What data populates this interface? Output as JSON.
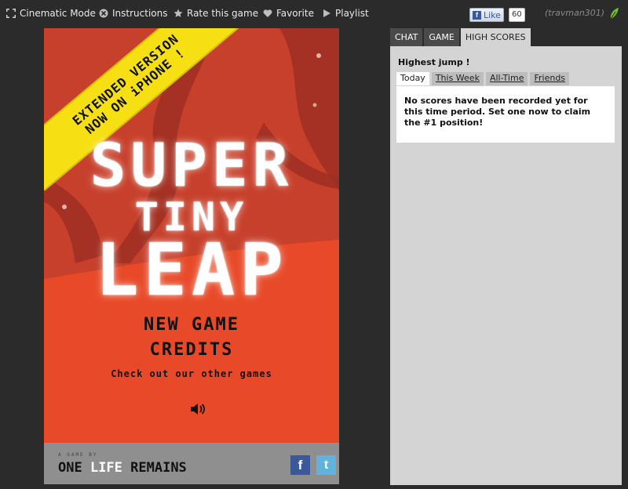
{
  "toolbar": {
    "cinematic": "Cinematic Mode",
    "instructions": "Instructions",
    "rate": "Rate this game",
    "favorite": "Favorite",
    "playlist": "Playlist",
    "like_label": "Like",
    "like_count": "60",
    "username": "(travman301)"
  },
  "game": {
    "banner_line1": "EXTENDED VERSION",
    "banner_line2": "NOW ON iPHONE !",
    "title_1": "SUPER",
    "title_2": "TINY",
    "title_3": "LEAP",
    "menu_new_game": "NEW GAME",
    "menu_credits": "CREDITS",
    "menu_other": "Check out our other games",
    "footer_by": "A GAME BY",
    "footer_studio_1": "ONE ",
    "footer_studio_2": "LIFE",
    "footer_studio_3": " REMAINS",
    "fb": "f",
    "tw": "t"
  },
  "panel": {
    "tabs": [
      "CHAT",
      "GAME",
      "HIGH SCORES"
    ],
    "active_tab": "HIGH SCORES",
    "title": "Highest jump !",
    "subtabs": [
      "Today",
      "This Week",
      "All-Time",
      "Friends"
    ],
    "active_subtab": "Today",
    "empty_message": "No scores have been recorded yet for this time period. Set one now to claim the #1 position!"
  },
  "colors": {
    "background": "#2b2b2b",
    "game_red": "#e8452a",
    "banner_yellow": "#f6e014",
    "panel_gray": "#d4d4d4"
  }
}
